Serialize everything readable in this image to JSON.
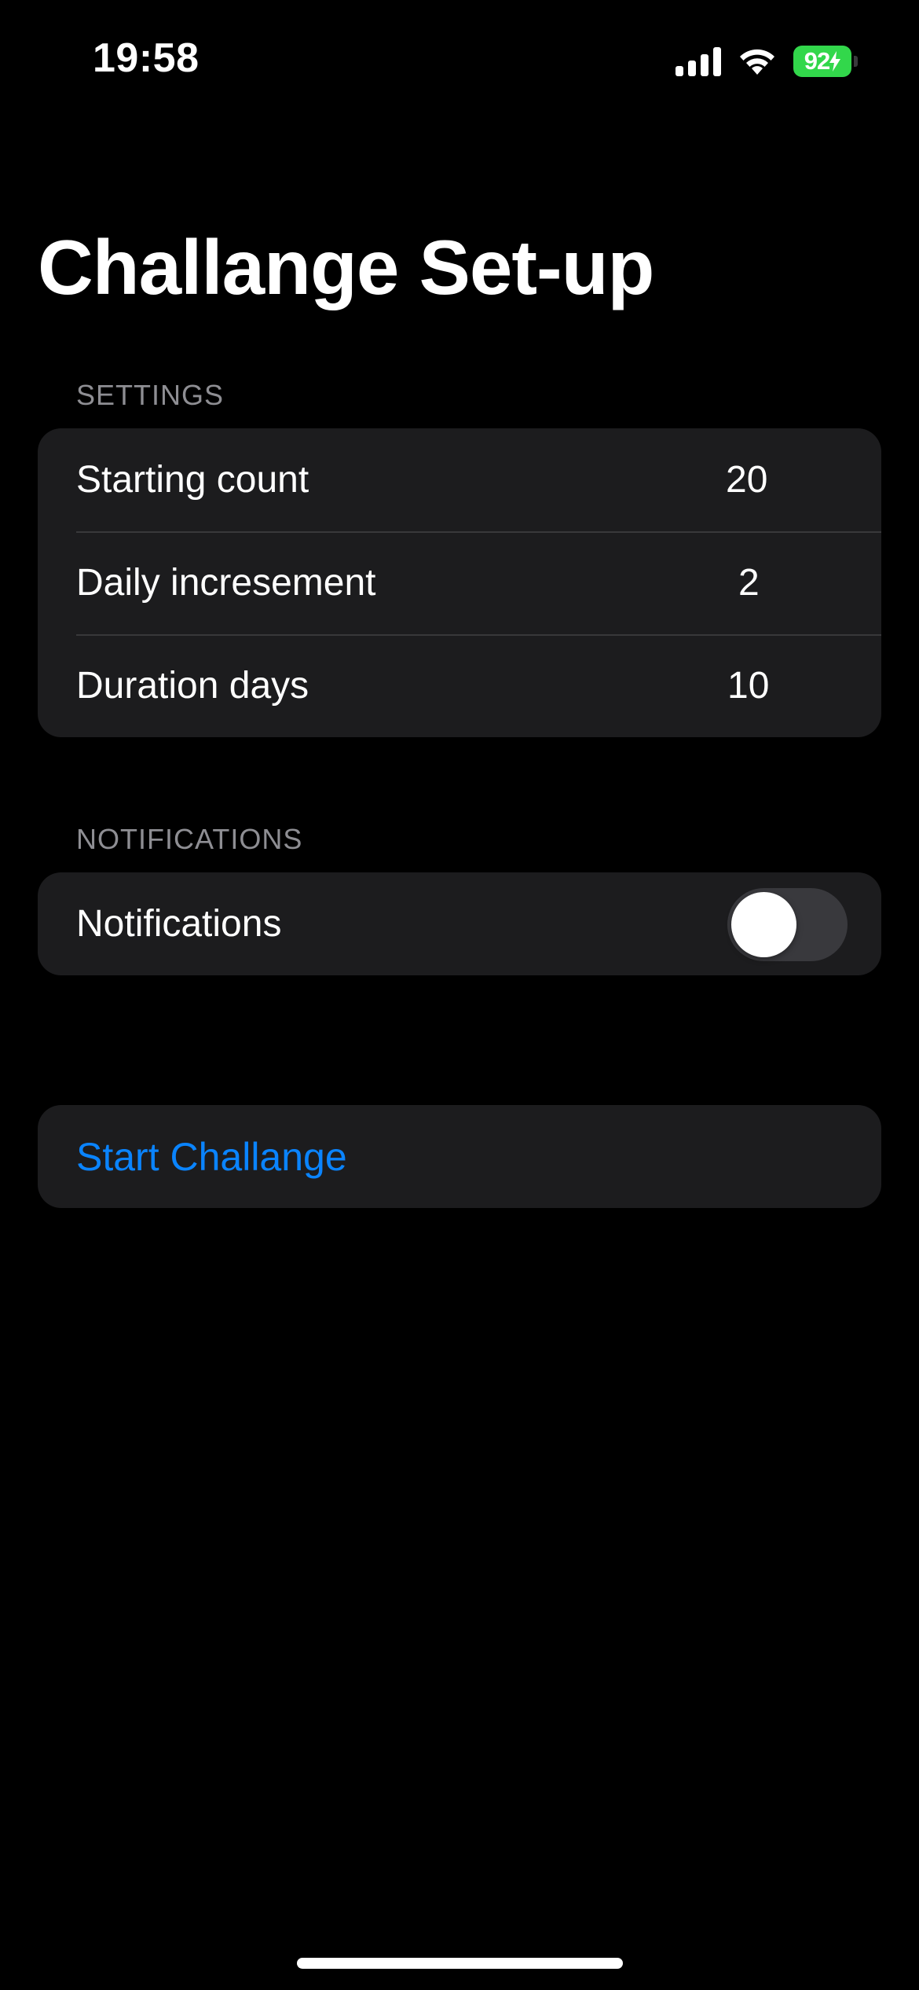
{
  "status_bar": {
    "time": "19:58",
    "battery_level": "92",
    "icons": [
      "signal-icon",
      "wifi-icon",
      "battery-icon",
      "charging-bolt-icon"
    ]
  },
  "page": {
    "title": "Challange Set-up"
  },
  "settings_section": {
    "header": "SETTINGS",
    "rows": [
      {
        "label": "Starting count",
        "value": "20"
      },
      {
        "label": "Daily incresement",
        "value": "2"
      },
      {
        "label": "Duration days",
        "value": "10"
      }
    ]
  },
  "notifications_section": {
    "header": "NOTIFICATIONS",
    "toggle_label": "Notifications",
    "toggle_on": false
  },
  "actions": {
    "start_label": "Start Challange"
  },
  "colors": {
    "background": "#000000",
    "group_background": "#1c1c1e",
    "accent": "#0a84ff",
    "battery": "#32d74b",
    "toggle_off": "#39393d",
    "section_header": "#8e8e93"
  }
}
